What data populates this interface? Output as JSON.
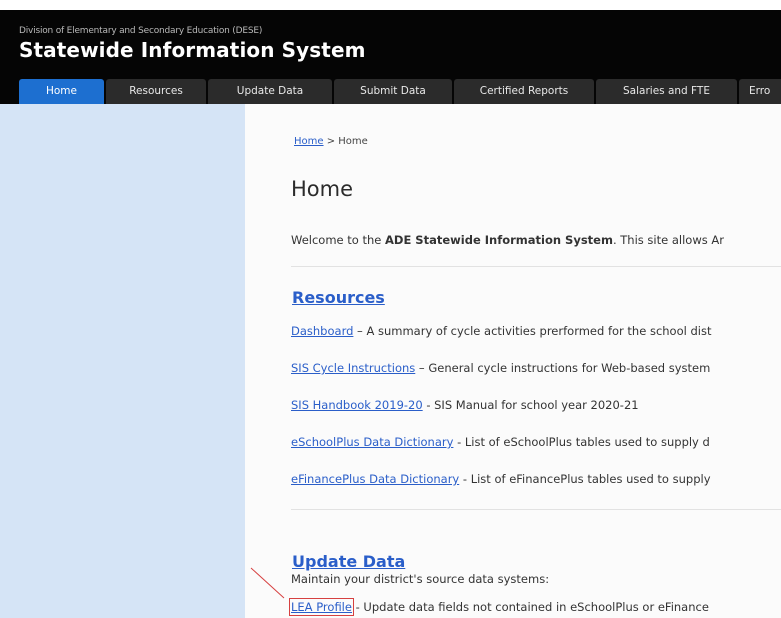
{
  "header": {
    "division": "Division of Elementary and Secondary Education (DESE)",
    "system_title": "Statewide Information System"
  },
  "nav": {
    "tabs": [
      {
        "label": "Home",
        "active": true
      },
      {
        "label": "Resources"
      },
      {
        "label": "Update Data"
      },
      {
        "label": "Submit Data"
      },
      {
        "label": "Certified Reports"
      },
      {
        "label": "Salaries and FTE"
      },
      {
        "label": "Erro"
      }
    ]
  },
  "breadcrumb": {
    "link": "Home",
    "separator": " > ",
    "current": "Home"
  },
  "page": {
    "title": "Home",
    "welcome_prefix": "Welcome to the ",
    "welcome_bold": "ADE Statewide Information System",
    "welcome_suffix": ". This site allows Ar"
  },
  "resources": {
    "title": "Resources",
    "items": [
      {
        "link": "Dashboard",
        "desc": " – A summary of cycle activities prerformed for the school dist"
      },
      {
        "link": "SIS Cycle Instructions",
        "desc": " – General cycle instructions for Web-based system"
      },
      {
        "link": "SIS Handbook 2019-20",
        "desc": " - SIS Manual for school year 2020-21"
      },
      {
        "link": "eSchoolPlus Data Dictionary",
        "desc": " - List of eSchoolPlus tables used to supply d"
      },
      {
        "link": "eFinancePlus Data Dictionary",
        "desc": " - List of eFinancePlus tables used to supply"
      }
    ]
  },
  "update_data": {
    "title": "Update Data",
    "intro": "Maintain your district's source data systems:",
    "items": [
      {
        "link": "LEA Profile",
        "desc": " - Update data fields not contained in eSchoolPlus or eFinance"
      }
    ]
  },
  "colors": {
    "header_bg": "#050505",
    "active_tab": "#1d6fd0",
    "tab_bg": "#2b2b2b",
    "sidebar_bg": "#d5e4f6",
    "link": "#2a5ec9",
    "annotation": "#d64040"
  }
}
